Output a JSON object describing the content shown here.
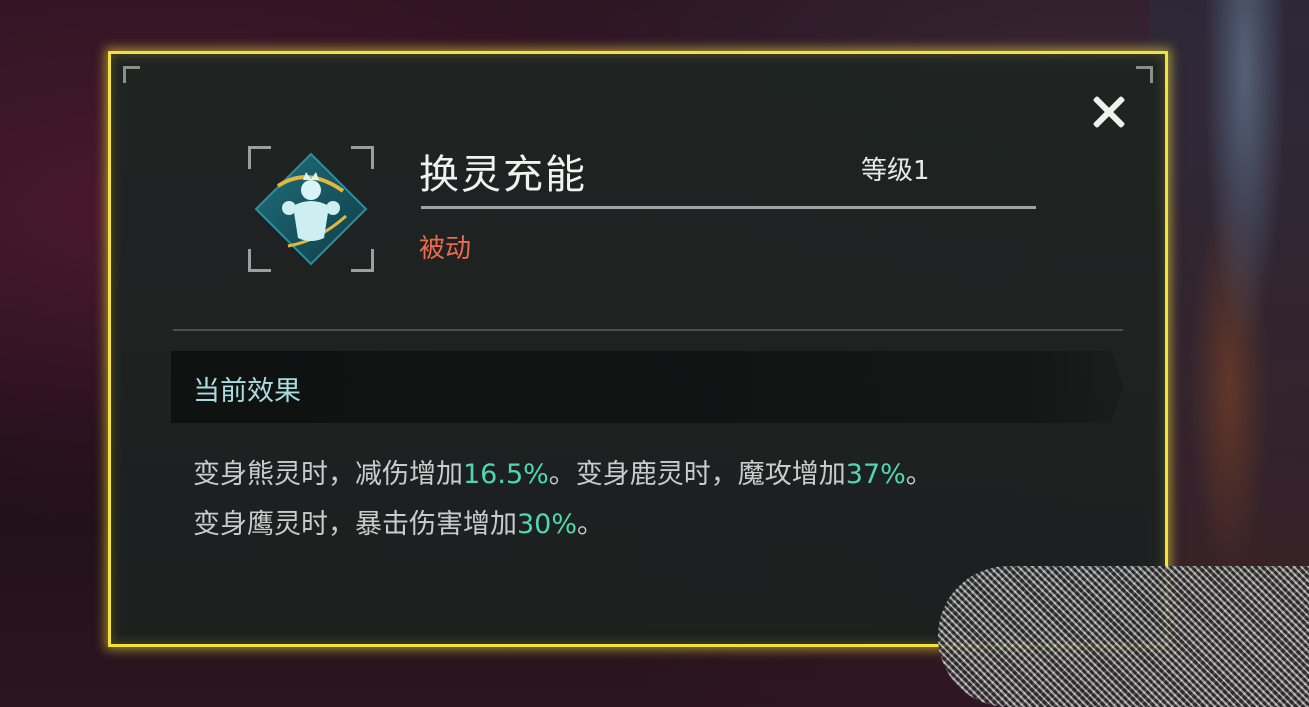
{
  "dialog": {
    "skill_name": "换灵充能",
    "level_label": "等级1",
    "skill_type": "被动",
    "close_icon": "close-icon",
    "skill_icon": "spirit-figure-icon"
  },
  "current_effect": {
    "header": "当前效果",
    "line1": {
      "part1": "变身熊灵时，减伤增加",
      "value1": "16.5%",
      "part2": "。变身鹿灵时，魔攻增加",
      "value2": "37%",
      "part3": "。"
    },
    "line2": {
      "part1": "变身鹰灵时，暴击伤害增加",
      "value1": "30%",
      "part2": "。"
    }
  },
  "colors": {
    "frame": "#f2e23a",
    "passive": "#ec6a4e",
    "highlight": "#4fd8b0",
    "section_title": "#a9dbe0"
  }
}
